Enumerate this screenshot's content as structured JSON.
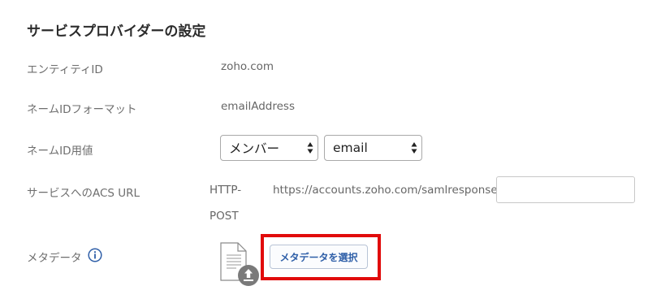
{
  "section": {
    "title": "サービスプロバイダーの設定"
  },
  "rows": {
    "entity_id": {
      "label": "エンティティID",
      "value": "zoho.com"
    },
    "name_id_format": {
      "label": "ネームIDフォーマット",
      "value": "emailAddress"
    },
    "name_id_value": {
      "label": "ネームID用値",
      "select1": "メンバー",
      "select2": "email"
    },
    "acs_url": {
      "label": "サービスへのACS URL",
      "binding_line1": "HTTP-",
      "binding_line2": "POST",
      "url": "https://accounts.zoho.com/samlresponse/",
      "input_value": ""
    },
    "metadata": {
      "label": "メタデータ",
      "button_label": "メタデータを選択"
    }
  },
  "icons": {
    "info": "info-icon",
    "file_upload": "file-upload-icon",
    "select_arrows": "select-arrows-icon"
  },
  "colors": {
    "highlight_border": "#e10b0b",
    "button_text": "#2f5fa8",
    "info_icon": "#2f5fa8"
  }
}
